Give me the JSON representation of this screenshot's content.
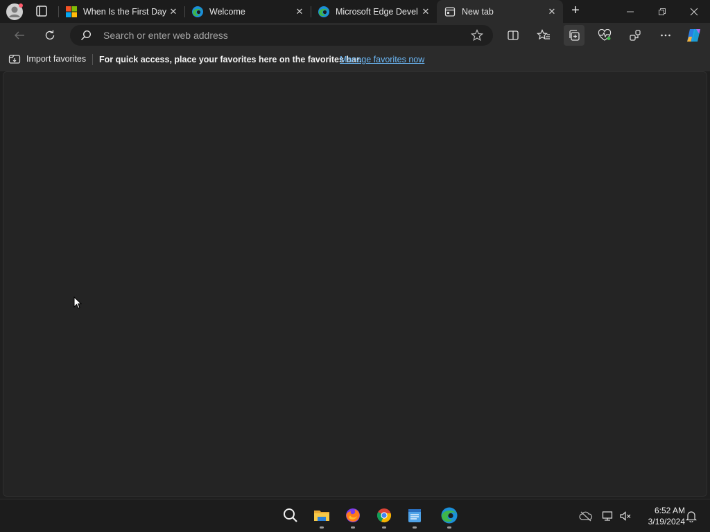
{
  "tabs": [
    {
      "title": "When Is the First Day",
      "favicon": "microsoft-logo-icon",
      "active": false
    },
    {
      "title": "Welcome",
      "favicon": "edge-icon",
      "active": false
    },
    {
      "title": "Microsoft Edge Devel",
      "favicon": "edge-icon",
      "active": false
    },
    {
      "title": "New tab",
      "favicon": "newtab-page-icon",
      "active": true
    }
  ],
  "tab_close_glyph": "✕",
  "new_tab_glyph": "+",
  "address_bar": {
    "placeholder": "Search or enter web address",
    "value": ""
  },
  "favorites_bar": {
    "import_label": "Import favorites",
    "message": "For quick access, place your favorites here on the favorites bar.",
    "link": "Manage favorites now"
  },
  "taskbar": {
    "apps": [
      "search-icon",
      "file-explorer-icon",
      "firefox-icon",
      "chrome-icon",
      "notepad-icon",
      "edge-icon"
    ],
    "clock": {
      "time": "6:52 AM",
      "date": "3/19/2024"
    }
  },
  "colors": {
    "titlebar": "#1c1c1c",
    "toolbar": "#2b2b2b",
    "content": "#242424",
    "link": "#6cb8f6",
    "edge_blue": "#1b8fd8",
    "edge_green": "#3fb54a"
  }
}
